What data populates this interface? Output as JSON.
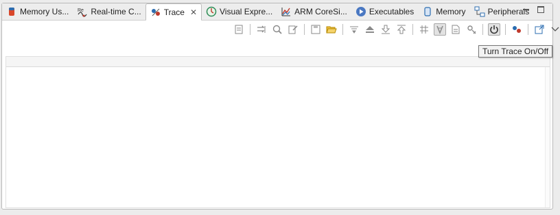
{
  "tabs": [
    {
      "label": "Memory Us...",
      "icon": "memory-usage-icon",
      "active": false
    },
    {
      "label": "Real-time C...",
      "icon": "realtime-icon",
      "active": false
    },
    {
      "label": "Trace",
      "icon": "trace-icon",
      "active": true
    },
    {
      "label": "Visual Expre...",
      "icon": "visual-expressions-icon",
      "active": false
    },
    {
      "label": "ARM CoreSi...",
      "icon": "coresight-icon",
      "active": false
    },
    {
      "label": "Executables",
      "icon": "executables-icon",
      "active": false
    },
    {
      "label": "Memory",
      "icon": "memory-icon",
      "active": false
    },
    {
      "label": "Peripherals",
      "icon": "peripherals-icon",
      "active": false
    }
  ],
  "tooltip": "Turn Trace On/Off",
  "colors": {
    "accent_red": "#c0392b",
    "accent_blue": "#2b6cb0",
    "accent_green": "#2e8b57",
    "toolbar_gray": "#8a8a8a"
  }
}
